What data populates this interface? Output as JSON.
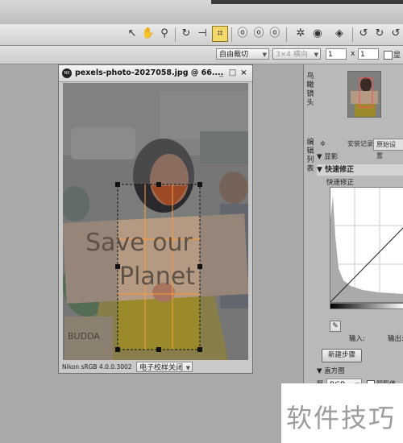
{
  "toolbar": {
    "tools": [
      "rotate-left-icon",
      "hand-icon",
      "zoom-icon",
      "rotate-icon",
      "straighten-icon",
      "crop-icon",
      "red-eye-icon",
      "retouch-brush-icon",
      "auto-retouch-icon",
      "color-control-point-icon",
      "selection-control-point-icon",
      "lasso-icon",
      "rotate-cw-icon",
      "flip-icon",
      "more-tools-icon"
    ]
  },
  "options": {
    "crop_mode": "自由裁切",
    "aspect": "3×4 横向",
    "width_value": "1",
    "times_label": "x",
    "height_value": "1",
    "show_label": "显"
  },
  "image_window": {
    "title": "pexels-photo-2027058.jpg  @  66....",
    "minimize": "_",
    "maximize": "□",
    "close": "×",
    "color_profile": "Nikon sRGB 4.0.0.3002",
    "soft_proof": "电子校样关闭",
    "sign_text_line1": "Save our",
    "sign_text_line2": "Planet",
    "fg_sign_text": "BUDDA"
  },
  "right_panel": {
    "birdseye_tab": "鸟瞰镜头",
    "edit_list_tab": "编辑列表",
    "section_label": "安装记录",
    "original_tab": "原始设置",
    "preview_label": "显影",
    "quick_fix_header": "快速修正",
    "quick_fix_label": "快速修正",
    "input_label": "输入:",
    "output_label": "输出:",
    "new_step_button": "新建步骤",
    "histogram_header": "直方图",
    "histogram_channel": "RGB",
    "histogram_option": "阴影值",
    "histogram_side": "照"
  },
  "watermark": {
    "text": "软件技巧"
  },
  "colors": {
    "accent": "#f4d86a",
    "crop_grid": "#ff9a3a",
    "panel": "#b9b9b9"
  }
}
